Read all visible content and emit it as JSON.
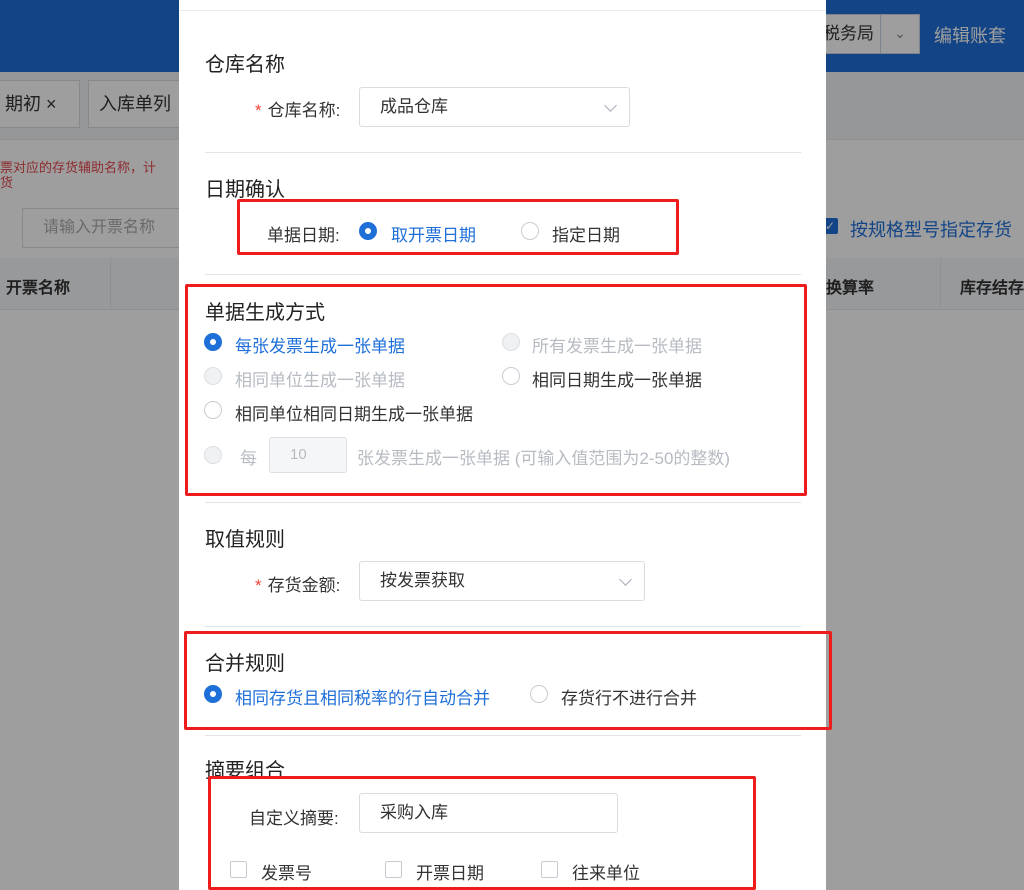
{
  "background": {
    "org_text": "税务局",
    "edit_account": "编辑账套",
    "tabs": [
      "期初 ×",
      "入库单列"
    ],
    "warning_line1": "票对应的存货辅助名称，计",
    "warning_line2": "货",
    "search_placeholder": "请输入开票名称",
    "spec_checkbox_label": "按规格型号指定存货",
    "table_headers": [
      "开票名称",
      "换算率",
      "库存结存数"
    ]
  },
  "dialog": {
    "warehouse": {
      "section_title": "仓库名称",
      "label": "仓库名称:",
      "value": "成品仓库"
    },
    "date": {
      "section_title": "日期确认",
      "label": "单据日期:",
      "options": [
        "取开票日期",
        "指定日期"
      ]
    },
    "generation": {
      "section_title": "单据生成方式",
      "options": [
        "每张发票生成一张单据",
        "所有发票生成一张单据",
        "相同单位生成一张单据",
        "相同日期生成一张单据",
        "相同单位相同日期生成一张单据"
      ],
      "per_prefix": "每",
      "per_value": "10",
      "per_suffix": "张发票生成一张单据 (可输入值范围为2-50的整数)"
    },
    "value_rule": {
      "section_title": "取值规则",
      "label": "存货金额:",
      "value": "按发票获取"
    },
    "merge_rule": {
      "section_title": "合并规则",
      "options": [
        "相同存货且相同税率的行自动合并",
        "存货行不进行合并"
      ]
    },
    "summary": {
      "section_title": "摘要组合",
      "label": "自定义摘要:",
      "value": "采购入库",
      "checkboxes": [
        "发票号",
        "开票日期",
        "往来单位"
      ]
    }
  },
  "colors": {
    "primary": "#1f6fd8",
    "highlight_box": "#ee1c1c",
    "required": "#f04438"
  }
}
